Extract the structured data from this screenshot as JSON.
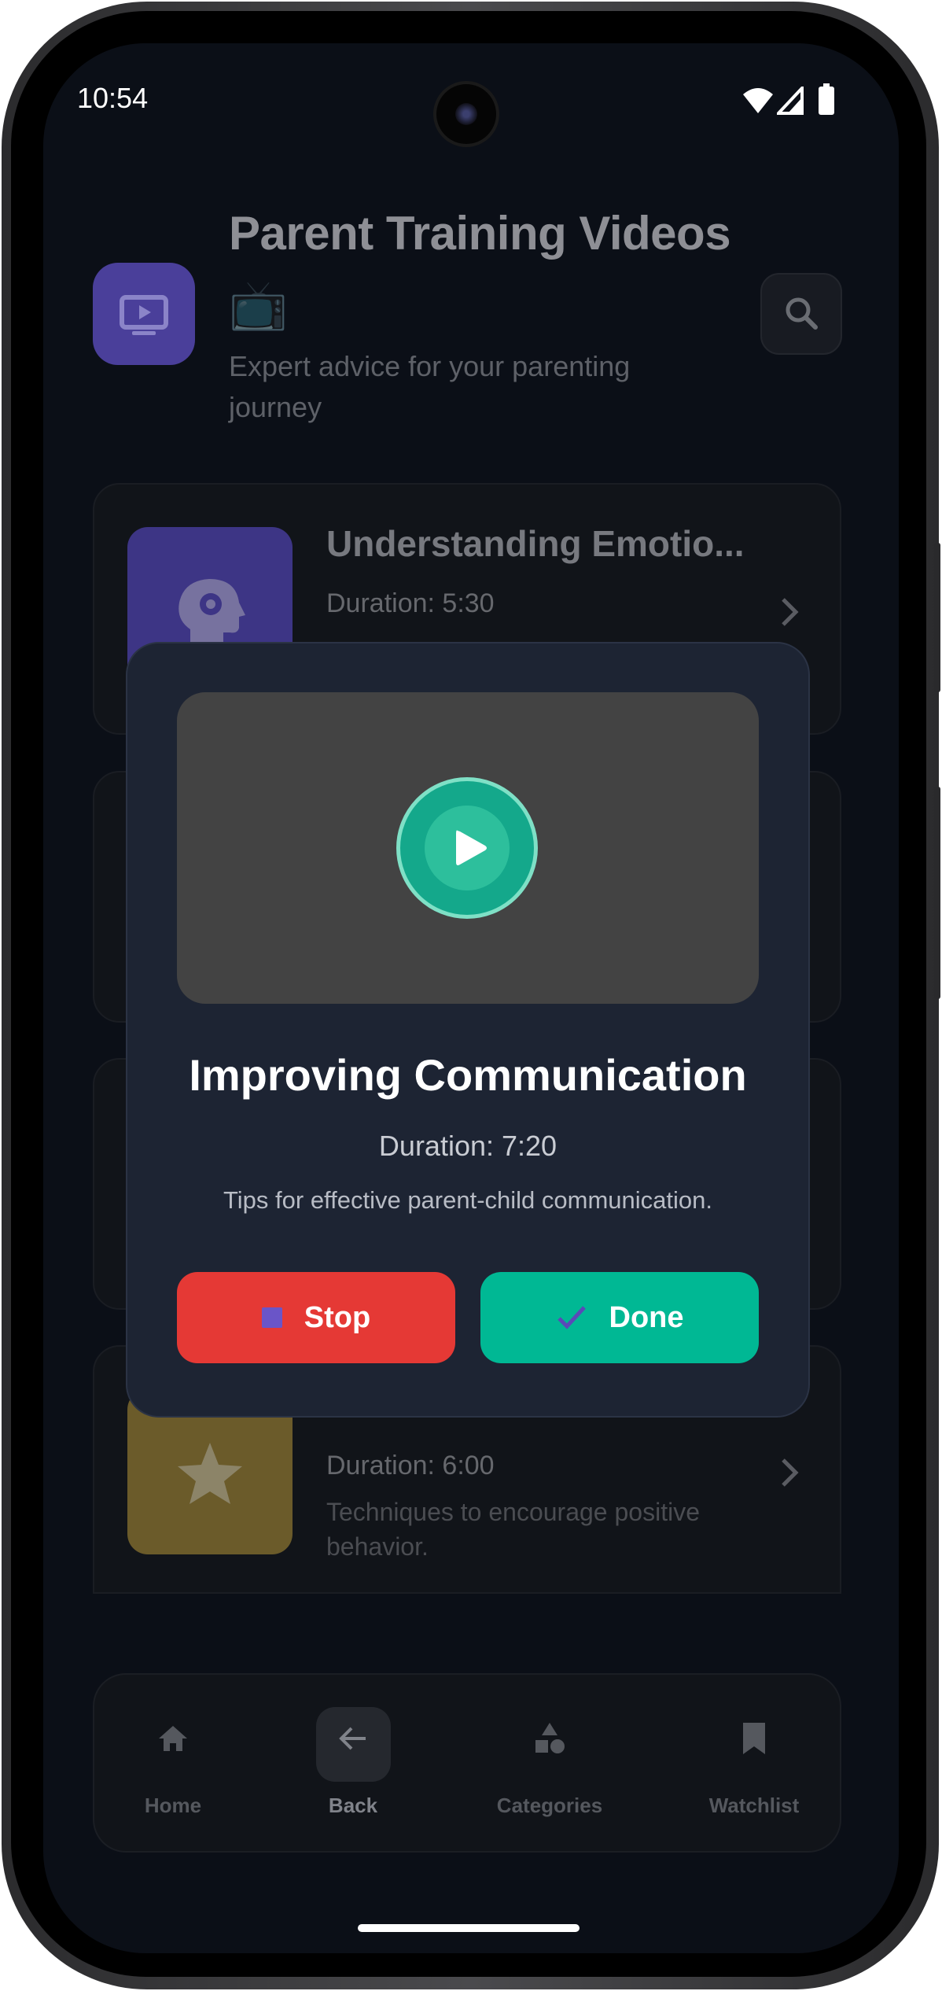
{
  "status_bar": {
    "time": "10:54"
  },
  "header": {
    "title": "Parent Training Videos",
    "title_emoji": "📺",
    "subtitle": "Expert advice for your parenting journey"
  },
  "videos": [
    {
      "title": "Understanding Emotio...",
      "duration": "Duration: 5:30",
      "description": "",
      "icon": "head-gear-icon"
    },
    {
      "title": "",
      "duration": "",
      "description": "",
      "icon": ""
    },
    {
      "title": "",
      "duration": "",
      "description": "",
      "icon": ""
    },
    {
      "title": "",
      "duration": "Duration: 6:00",
      "description": "Techniques to encourage positive behavior.",
      "icon": "star-icon"
    }
  ],
  "modal": {
    "title": "Improving Communication",
    "duration": "Duration: 7:20",
    "description": "Tips for effective parent-child communication.",
    "stop_label": "Stop",
    "done_label": "Done"
  },
  "nav": {
    "items": [
      {
        "label": "Home",
        "icon": "home-icon"
      },
      {
        "label": "Back",
        "icon": "arrow-left-icon"
      },
      {
        "label": "Categories",
        "icon": "shapes-icon"
      },
      {
        "label": "Watchlist",
        "icon": "bookmark-icon"
      }
    ]
  },
  "colors": {
    "background": "#0b0f17",
    "modal": "#1d2433",
    "stop": "#e53935",
    "done": "#00b894",
    "play": "#14a88b",
    "accent_purple": "#4a3f9a"
  }
}
